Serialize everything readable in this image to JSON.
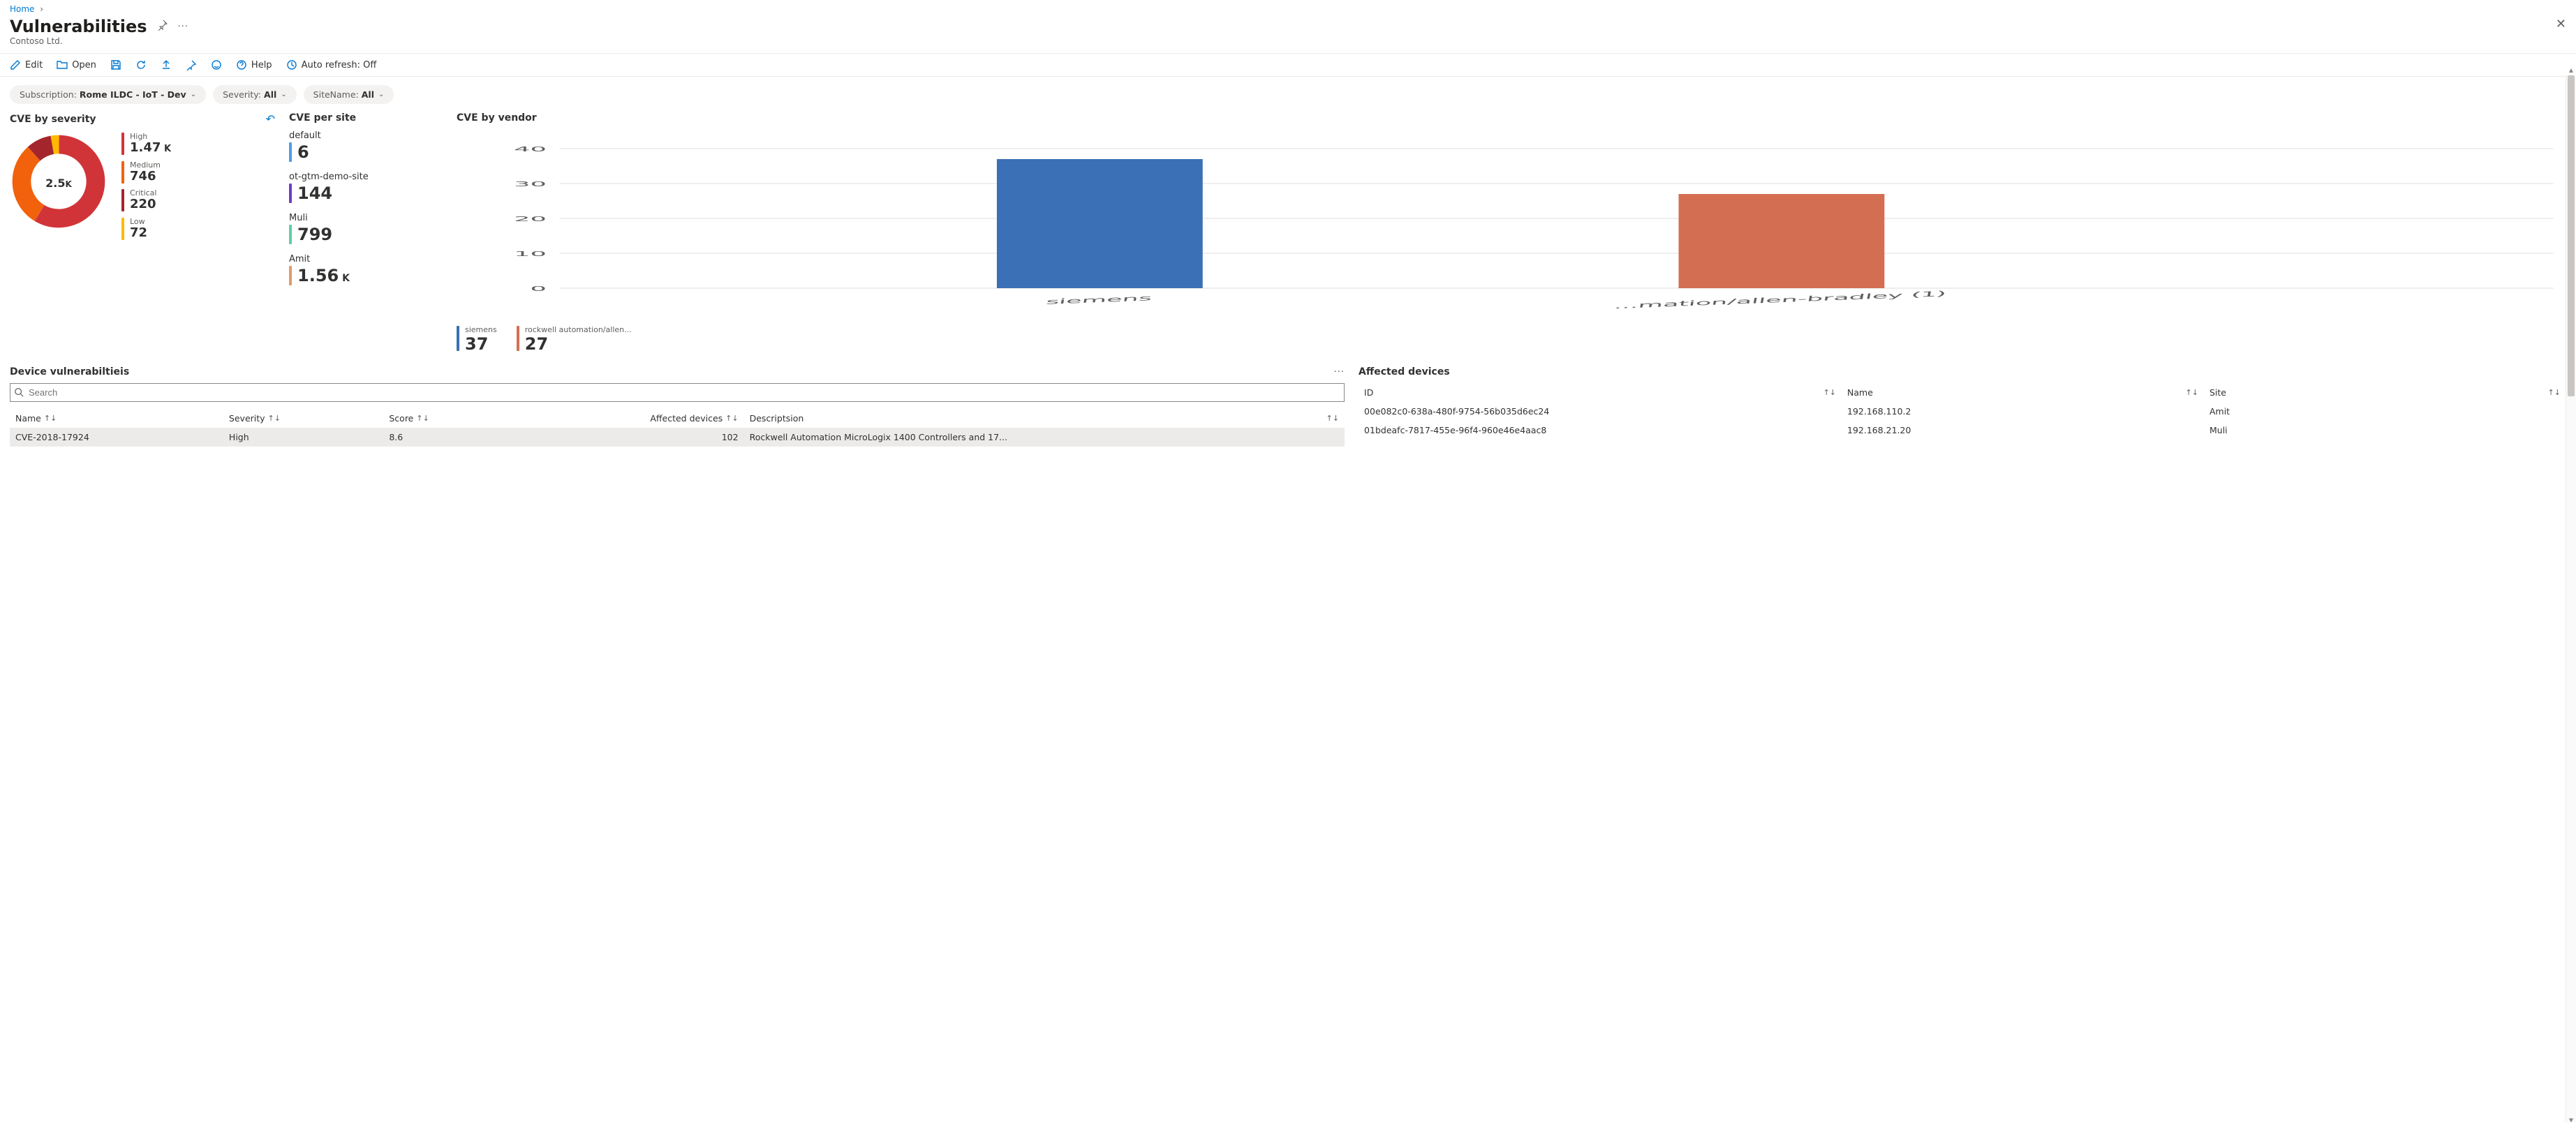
{
  "breadcrumb": {
    "home": "Home"
  },
  "page": {
    "title": "Vulnerabilities",
    "subtitle": "Contoso Ltd."
  },
  "toolbar": {
    "edit": "Edit",
    "open": "Open",
    "help": "Help",
    "auto_refresh": "Auto refresh: Off"
  },
  "filters": {
    "sub_label": "Subscription: ",
    "sub_value": "Rome ILDC - IoT - Dev",
    "sev_label": "Severity: ",
    "sev_value": "All",
    "site_label": "SiteName: ",
    "site_value": "All"
  },
  "sev_panel": {
    "title": "CVE by severity",
    "total": "2.5",
    "total_suffix": "K",
    "items": [
      {
        "label": "High",
        "value": "1.47",
        "suffix": " K",
        "color": "#d13438"
      },
      {
        "label": "Medium",
        "value": "746",
        "suffix": "",
        "color": "#f2610c"
      },
      {
        "label": "Critical",
        "value": "220",
        "suffix": "",
        "color": "#a4262c"
      },
      {
        "label": "Low",
        "value": "72",
        "suffix": "",
        "color": "#ffb900"
      }
    ]
  },
  "site_panel": {
    "title": "CVE per site",
    "items": [
      {
        "name": "default",
        "value": "6",
        "suffix": "",
        "color": "#4f9de6"
      },
      {
        "name": "ot-gtm-demo-site",
        "value": "144",
        "suffix": "",
        "color": "#6b3fc4"
      },
      {
        "name": "Muli",
        "value": "799",
        "suffix": "",
        "color": "#5fd0a4"
      },
      {
        "name": "Amit",
        "value": "1.56",
        "suffix": " K",
        "color": "#e09c6a"
      }
    ]
  },
  "vendor_panel": {
    "title": "CVE by vendor",
    "legend": [
      {
        "name": "siemens",
        "value": "37",
        "color": "#3b6fb6"
      },
      {
        "name": "rockwell automation/allen...",
        "value": "27",
        "color": "#d46e52"
      }
    ],
    "chart_data": {
      "type": "bar",
      "categories": [
        "siemens",
        "rockwell automation/allen-bradley (1)"
      ],
      "series": [
        {
          "name": "siemens",
          "values": [
            37,
            null
          ],
          "color": "#3b6fb6"
        },
        {
          "name": "rockwell automation/allen-bradley",
          "values": [
            null,
            27
          ],
          "color": "#d46e52"
        }
      ],
      "ylim": [
        0,
        40
      ],
      "yticks": [
        0,
        10,
        20,
        30,
        40
      ],
      "title": "CVE by vendor",
      "xlabel": "",
      "ylabel": ""
    }
  },
  "chart_data": [
    {
      "type": "pie",
      "title": "CVE by severity",
      "total": 2500,
      "slices": [
        {
          "label": "High",
          "value": 1470,
          "color": "#d13438"
        },
        {
          "label": "Medium",
          "value": 746,
          "color": "#f2610c"
        },
        {
          "label": "Critical",
          "value": 220,
          "color": "#a4262c"
        },
        {
          "label": "Low",
          "value": 72,
          "color": "#ffb900"
        }
      ]
    },
    {
      "type": "bar",
      "title": "CVE by vendor",
      "categories": [
        "siemens",
        "rockwell automation/allen-bradley (1)"
      ],
      "values": [
        37,
        27
      ],
      "ylim": [
        0,
        40
      ]
    }
  ],
  "dev_vuln": {
    "title": "Device vulnerabiltieis",
    "search_placeholder": "Search",
    "cols": {
      "name": "Name",
      "sev": "Severity",
      "score": "Score",
      "aff": "Affected devices",
      "desc": "Descriptsion"
    },
    "rows": [
      {
        "name": "CVE-2018-17924",
        "sev": "High",
        "score": "8.6",
        "aff": "102",
        "desc": "Rockwell Automation MicroLogix 1400 Controllers and 17..."
      }
    ]
  },
  "aff_dev": {
    "title": "Affected devices",
    "cols": {
      "id": "ID",
      "name": "Name",
      "site": "Site"
    },
    "rows": [
      {
        "id": "00e082c0-638a-480f-9754-56b035d6ec24",
        "name": "192.168.110.2",
        "site": "Amit"
      },
      {
        "id": "01bdeafc-7817-455e-96f4-960e46e4aac8",
        "name": "192.168.21.20",
        "site": "Muli"
      }
    ]
  },
  "colors": {
    "link": "#0078d4"
  }
}
